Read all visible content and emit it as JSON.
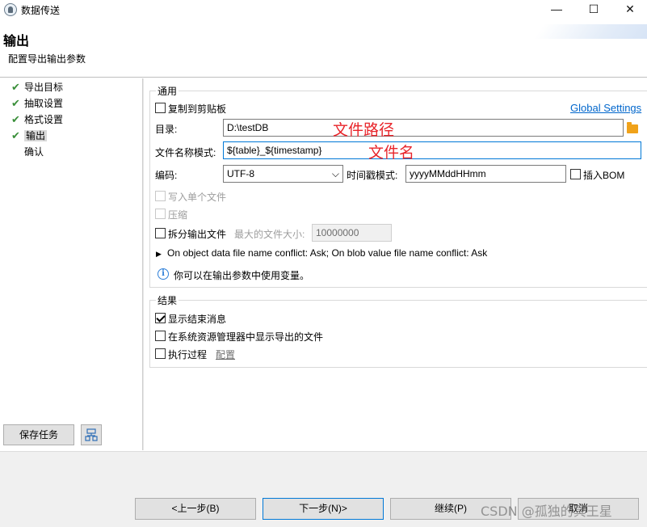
{
  "window": {
    "title": "数据传送",
    "minimize_glyph": "—",
    "maximize_glyph": "☐",
    "close_glyph": "✕"
  },
  "header": {
    "title": "输出",
    "description": "配置导出输出参数"
  },
  "sidebar": {
    "items": [
      {
        "label": "导出目标",
        "done": true
      },
      {
        "label": "抽取设置",
        "done": true
      },
      {
        "label": "格式设置",
        "done": true
      },
      {
        "label": "输出",
        "done": true,
        "active": true
      },
      {
        "label": "确认",
        "done": false
      }
    ],
    "check_glyph": "✔",
    "save_task_label": "保存任务",
    "task_icon": "task-config-icon"
  },
  "general": {
    "group_title": "通用",
    "copy_to_clipboard": {
      "label": "复制到剪贴板",
      "checked": false
    },
    "global_settings_link": "Global Settings",
    "directory": {
      "label": "目录:",
      "value": "D:\\testDB",
      "annotation": "文件路径"
    },
    "file_name_pattern": {
      "label": "文件名称模式:",
      "value": "${table}_${timestamp}",
      "annotation": "文件名"
    },
    "encoding": {
      "label": "编码:",
      "value": "UTF-8",
      "chevron": "⌵"
    },
    "timestamp_pattern": {
      "label": "时间戳模式:",
      "value": "yyyyMMddHHmm"
    },
    "insert_bom": {
      "label": "插入BOM",
      "checked": false
    },
    "write_single_file": {
      "label": "写入单个文件",
      "checked": false,
      "disabled": true
    },
    "compress": {
      "label": "压缩",
      "checked": false,
      "disabled": true
    },
    "split_output": {
      "label": "拆分输出文件",
      "checked": false
    },
    "max_file_size": {
      "label": "最大的文件大小:",
      "value": "10000000"
    },
    "conflict_toggle": "▶",
    "conflict_text": "On object data file name conflict: Ask; On blob value file name conflict: Ask",
    "info_glyph": "i",
    "info_text": "你可以在输出参数中使用变量。"
  },
  "result": {
    "group_title": "结果",
    "show_finish_message": {
      "label": "显示结束消息",
      "checked": true
    },
    "show_in_explorer": {
      "label": "在系统资源管理器中显示导出的文件",
      "checked": false
    },
    "execute_process": {
      "label": "执行过程",
      "checked": false
    },
    "configure_link": "配置"
  },
  "footer": {
    "back_label": "<上一步(B)",
    "next_label": "下一步(N)>",
    "continue_label": "继续(P)",
    "cancel_label": "取消"
  },
  "watermark": "CSDN @孤独的冥王星",
  "colors": {
    "accent": "#0078d7",
    "link": "#0066cc",
    "annotation": "#e8242a",
    "check": "#3a8f3a",
    "folder": "#f0a21a"
  }
}
